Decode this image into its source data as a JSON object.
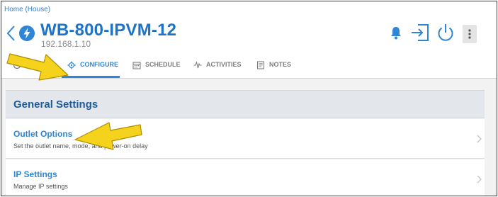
{
  "breadcrumb": "Home (House)",
  "device": {
    "name": "WB-800-IPVM-12",
    "ip": "192.168.1.10"
  },
  "header_icons": [
    "bell-icon",
    "login-icon",
    "power-icon",
    "more-vertical-icon"
  ],
  "tabs": [
    {
      "label": "",
      "icon": "dashboard-icon"
    },
    {
      "label": "CONFIGURE",
      "icon": "gear-icon",
      "active": true
    },
    {
      "label": "SCHEDULE",
      "icon": "calendar-icon"
    },
    {
      "label": "ACTIVITIES",
      "icon": "pulse-icon"
    },
    {
      "label": "NOTES",
      "icon": "notes-icon"
    }
  ],
  "section": {
    "title": "General Settings"
  },
  "rows": [
    {
      "title": "Outlet Options",
      "subtitle": "Set the outlet name, mode, and power-on delay"
    },
    {
      "title": "IP Settings",
      "subtitle": "Manage IP settings"
    }
  ],
  "colors": {
    "accent": "#2f86d6",
    "title_blue": "#1e73c6",
    "section_blue": "#1d5c9c",
    "annotation_arrow": "#f5d21c"
  },
  "annotations": [
    "annotation-arrow-configure",
    "annotation-arrow-outlet-options"
  ]
}
